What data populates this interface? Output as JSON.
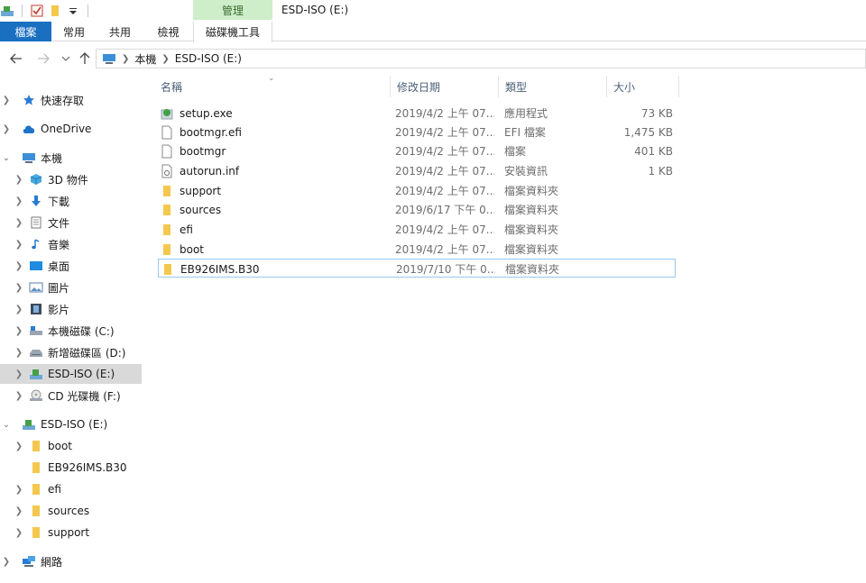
{
  "window": {
    "title": "ESD-ISO (E:)",
    "context_tab_group": "管理"
  },
  "ribbon": {
    "tabs": [
      {
        "label": "檔案"
      },
      {
        "label": "常用"
      },
      {
        "label": "共用"
      },
      {
        "label": "檢視"
      },
      {
        "label": "磁碟機工具"
      }
    ]
  },
  "address": {
    "breadcrumbs": [
      "本機",
      "ESD-ISO (E:)"
    ]
  },
  "nav_pane": {
    "items": [
      {
        "label": "快速存取",
        "icon": "star-icon"
      },
      {
        "label": "OneDrive",
        "icon": "cloud-icon"
      },
      {
        "label": "本機",
        "icon": "computer-icon"
      },
      {
        "label": "3D 物件",
        "icon": "cube-icon"
      },
      {
        "label": "下載",
        "icon": "download-icon"
      },
      {
        "label": "文件",
        "icon": "document-icon"
      },
      {
        "label": "音樂",
        "icon": "music-icon"
      },
      {
        "label": "桌面",
        "icon": "desktop-icon"
      },
      {
        "label": "圖片",
        "icon": "picture-icon"
      },
      {
        "label": "影片",
        "icon": "video-icon"
      },
      {
        "label": "本機磁碟 (C:)",
        "icon": "drive-icon"
      },
      {
        "label": "新增磁碟區 (D:)",
        "icon": "drive-icon"
      },
      {
        "label": "ESD-ISO (E:)",
        "icon": "dvd-drive-icon"
      },
      {
        "label": "CD 光碟機 (F:)",
        "icon": "cd-drive-icon"
      },
      {
        "label": "ESD-ISO (E:)",
        "icon": "dvd-drive-icon"
      },
      {
        "label": "boot",
        "icon": "folder-icon"
      },
      {
        "label": "EB926IMS.B30",
        "icon": "folder-icon"
      },
      {
        "label": "efi",
        "icon": "folder-icon"
      },
      {
        "label": "sources",
        "icon": "folder-icon"
      },
      {
        "label": "support",
        "icon": "folder-icon"
      },
      {
        "label": "網路",
        "icon": "network-icon"
      }
    ]
  },
  "file_list": {
    "columns": [
      "名稱",
      "修改日期",
      "類型",
      "大小"
    ],
    "rows": [
      {
        "name": "setup.exe",
        "date": "2019/4/2 上午 07...",
        "type": "應用程式",
        "size": "73 KB",
        "icon": "setup-icon"
      },
      {
        "name": "bootmgr.efi",
        "date": "2019/4/2 上午 07...",
        "type": "EFI 檔案",
        "size": "1,475 KB",
        "icon": "file-icon"
      },
      {
        "name": "bootmgr",
        "date": "2019/4/2 上午 07...",
        "type": "檔案",
        "size": "401 KB",
        "icon": "file-icon"
      },
      {
        "name": "autorun.inf",
        "date": "2019/4/2 上午 07...",
        "type": "安裝資訊",
        "size": "1 KB",
        "icon": "inf-file-icon"
      },
      {
        "name": "support",
        "date": "2019/4/2 上午 07...",
        "type": "檔案資料夾",
        "size": "",
        "icon": "folder-icon"
      },
      {
        "name": "sources",
        "date": "2019/6/17 下午 0...",
        "type": "檔案資料夾",
        "size": "",
        "icon": "folder-icon"
      },
      {
        "name": "efi",
        "date": "2019/4/2 上午 07...",
        "type": "檔案資料夾",
        "size": "",
        "icon": "folder-icon"
      },
      {
        "name": "boot",
        "date": "2019/4/2 上午 07...",
        "type": "檔案資料夾",
        "size": "",
        "icon": "folder-icon"
      },
      {
        "name": "EB926IMS.B30",
        "date": "2019/7/10 下午 0...",
        "type": "檔案資料夾",
        "size": "",
        "icon": "folder-icon"
      }
    ]
  },
  "colors": {
    "file_tab": "#1a6fc1",
    "context_tab": "#cdeec9",
    "selection": "#d9d9d9",
    "focus_border": "#99c9ef",
    "folder": "#f3c84d"
  }
}
